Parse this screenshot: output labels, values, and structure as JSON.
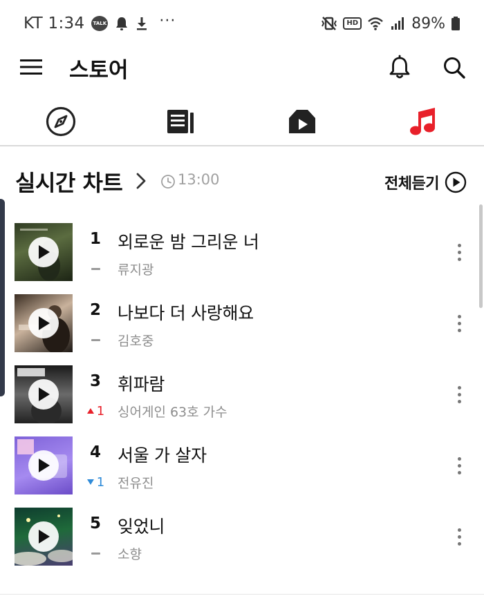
{
  "status_bar": {
    "carrier_time": "KT 1:34",
    "talk_badge": "TALK",
    "more": "···",
    "hd_badge": "HD",
    "battery": "89%"
  },
  "app_bar": {
    "title": "스토어",
    "icons": [
      "menu-icon",
      "bell-icon",
      "search-icon"
    ]
  },
  "nav_tabs": [
    {
      "name": "discover",
      "icon": "compass-icon",
      "active": false
    },
    {
      "name": "books",
      "icon": "book-list-icon",
      "active": false
    },
    {
      "name": "movies",
      "icon": "movie-play-icon",
      "active": false
    },
    {
      "name": "music",
      "icon": "music-note-icon",
      "active": true
    }
  ],
  "colors": {
    "accent": "#e8202a",
    "up": "#e8202a",
    "down": "#2f8bd8",
    "muted_text": "#8d8d8d",
    "divider": "#d9d9d9"
  },
  "chart": {
    "title": "실시간 차트",
    "time": "13:00",
    "listen_all": "전체듣기",
    "items": [
      {
        "rank": "1",
        "title": "외로운 밤 그리운 너",
        "artist": "류지광",
        "change_type": "same",
        "change": ""
      },
      {
        "rank": "2",
        "title": "나보다 더 사랑해요",
        "artist": "김호중",
        "change_type": "same",
        "change": ""
      },
      {
        "rank": "3",
        "title": "휘파람",
        "artist": "싱어게인 63호 가수",
        "change_type": "up",
        "change": "1"
      },
      {
        "rank": "4",
        "title": "서울 가 살자",
        "artist": "전유진",
        "change_type": "down",
        "change": "1"
      },
      {
        "rank": "5",
        "title": "잊었니",
        "artist": "소향",
        "change_type": "same",
        "change": ""
      }
    ]
  }
}
